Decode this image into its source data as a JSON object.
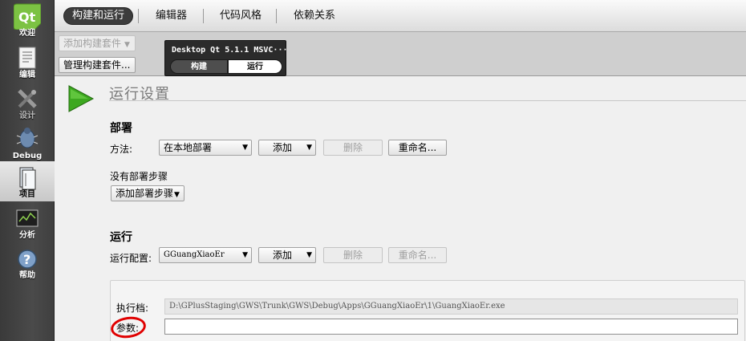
{
  "sidebar": {
    "items": [
      {
        "label": "欢迎",
        "icon": "qt-logo-icon"
      },
      {
        "label": "编辑",
        "icon": "document-icon"
      },
      {
        "label": "设计",
        "icon": "design-tools-icon"
      },
      {
        "label": "Debug",
        "icon": "bug-icon"
      },
      {
        "label": "项目",
        "icon": "project-icon"
      },
      {
        "label": "分析",
        "icon": "analyze-monitor-icon"
      },
      {
        "label": "帮助",
        "icon": "help-icon"
      }
    ],
    "active_index": 4
  },
  "top_tabs": [
    "构建和运行",
    "编辑器",
    "代码风格",
    "依赖关系"
  ],
  "kit": {
    "add_kit_label": "添加构建套件",
    "manage_kits_label": "管理构建套件...",
    "name": "Desktop Qt 5.1.1 MSVC···",
    "build_label": "构建",
    "run_label": "运行"
  },
  "page": {
    "title": "运行设置",
    "deploy": {
      "heading": "部署",
      "method_label": "方法:",
      "method_value": "在本地部署",
      "add_label": "添加",
      "delete_label": "删除",
      "rename_label": "重命名...",
      "no_steps_label": "没有部署步骤",
      "add_step_label": "添加部署步骤"
    },
    "run": {
      "heading": "运行",
      "config_label": "运行配置:",
      "config_value": "GGuangXiaoEr",
      "add_label": "添加",
      "delete_label": "删除",
      "rename_label": "重命名...",
      "executable_label": "执行档:",
      "executable_value": "D:\\GPlusStaging\\GWS\\Trunk\\GWS\\Debug\\Apps\\GGuangXiaoEr\\1\\GuangXiaoEr.exe",
      "arguments_label": "参数:",
      "arguments_value": ""
    }
  },
  "colors": {
    "sidebar_bg": "#454545",
    "active_tab_bg": "#3c3c3c",
    "run_icon_green": "#3da820",
    "annotation_red": "#e00000"
  }
}
